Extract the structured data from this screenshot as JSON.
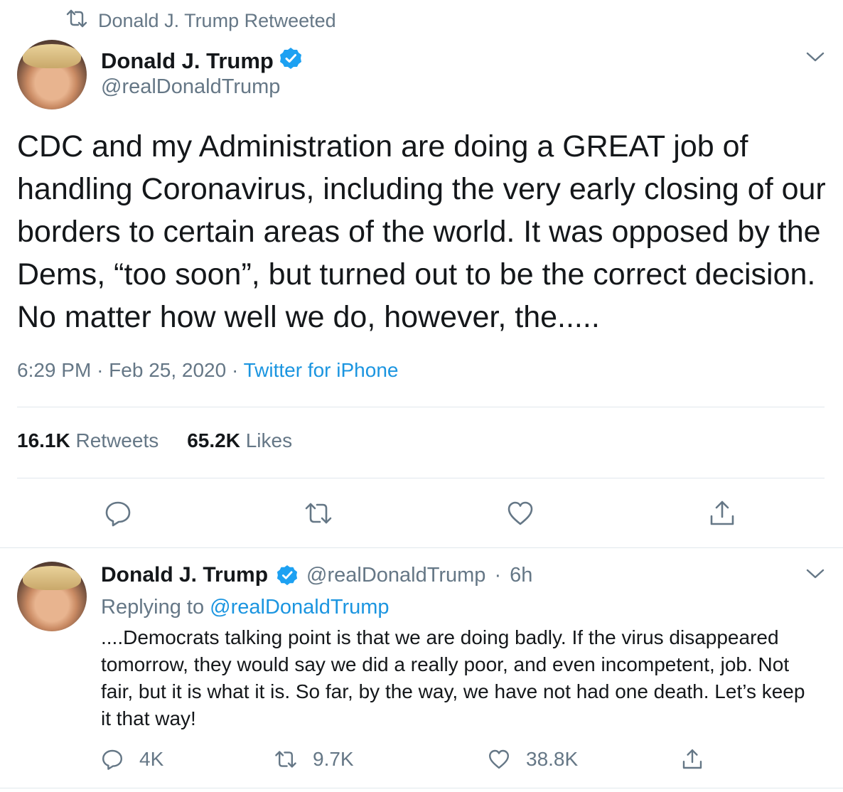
{
  "retweet_header": {
    "text": "Donald J. Trump Retweeted",
    "icon": "retweet-icon"
  },
  "main_tweet": {
    "author_name": "Donald J. Trump",
    "handle": "@realDonaldTrump",
    "verified": true,
    "text": "CDC and my Administration are doing a GREAT job of handling Coronavirus, including the very early closing of our borders to certain areas of the world. It was opposed by the Dems, “too soon”, but turned out to be the correct decision. No matter how well we do, however, the.....",
    "time": "6:29 PM",
    "date": "Feb 25, 2020",
    "separator": "·",
    "source": "Twitter for iPhone",
    "retweets_count": "16.1K",
    "retweets_label": "Retweets",
    "likes_count": "65.2K",
    "likes_label": "Likes",
    "actions": [
      "reply-icon",
      "retweet-icon",
      "like-icon",
      "share-icon"
    ]
  },
  "reply_tweet": {
    "author_name": "Donald J. Trump",
    "handle": "@realDonaldTrump",
    "separator": "·",
    "age": "6h",
    "replying_to_prefix": "Replying to",
    "replying_to_handle": "@realDonaldTrump",
    "text": "....Democrats talking point is that we are doing badly. If the virus disappeared tomorrow, they would say we did a really poor, and even incompetent, job. Not fair, but it is what it is. So far, by the way, we have not had one death. Let’s keep it that way!",
    "reply_count": "4K",
    "retweet_count": "9.7K",
    "like_count": "38.8K"
  },
  "colors": {
    "text": "#14171a",
    "muted": "#657786",
    "link": "#1b95e0",
    "divider": "#e1e8ed",
    "verified": "#1da1f2"
  }
}
